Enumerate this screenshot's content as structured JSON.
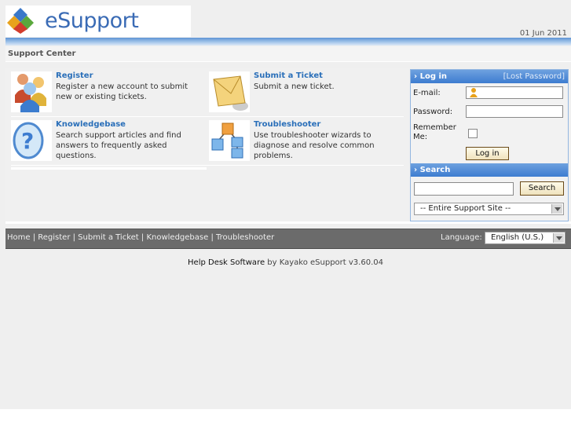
{
  "header": {
    "logo_text": "eSupport",
    "date": "01 Jun 2011"
  },
  "title_bar": {
    "title": "Support Center"
  },
  "tiles": [
    {
      "name": "Register",
      "desc": "Register a new account to submit new or existing tickets.",
      "icon": "users-icon"
    },
    {
      "name": "Submit a Ticket",
      "desc": "Submit a new ticket.",
      "icon": "envelope-icon"
    },
    {
      "name": "Knowledgebase",
      "desc": "Search support articles and find answers to frequently asked questions.",
      "icon": "question-icon"
    },
    {
      "name": "Troubleshooter",
      "desc": "Use troubleshooter wizards to diagnose and resolve common problems.",
      "icon": "cubes-icon"
    }
  ],
  "login": {
    "heading": "Log in",
    "lost_password": "[Lost Password]",
    "email_label": "E-mail:",
    "password_label": "Password:",
    "remember_label": "Remember Me:",
    "button": "Log in"
  },
  "search": {
    "heading": "Search",
    "button": "Search",
    "scope": "-- Entire Support Site --"
  },
  "nav": {
    "links": [
      "Home",
      "Register",
      "Submit a Ticket",
      "Knowledgebase",
      "Troubleshooter"
    ],
    "language_label": "Language:",
    "language_value": "English (U.S.)"
  },
  "credit": {
    "link": "Help Desk Software",
    "rest": "by Kayako eSupport v3.60.04"
  },
  "colors": {
    "accent": "#3d7cd0",
    "link": "#2a6fb9",
    "navbar": "#6b6b6b"
  }
}
